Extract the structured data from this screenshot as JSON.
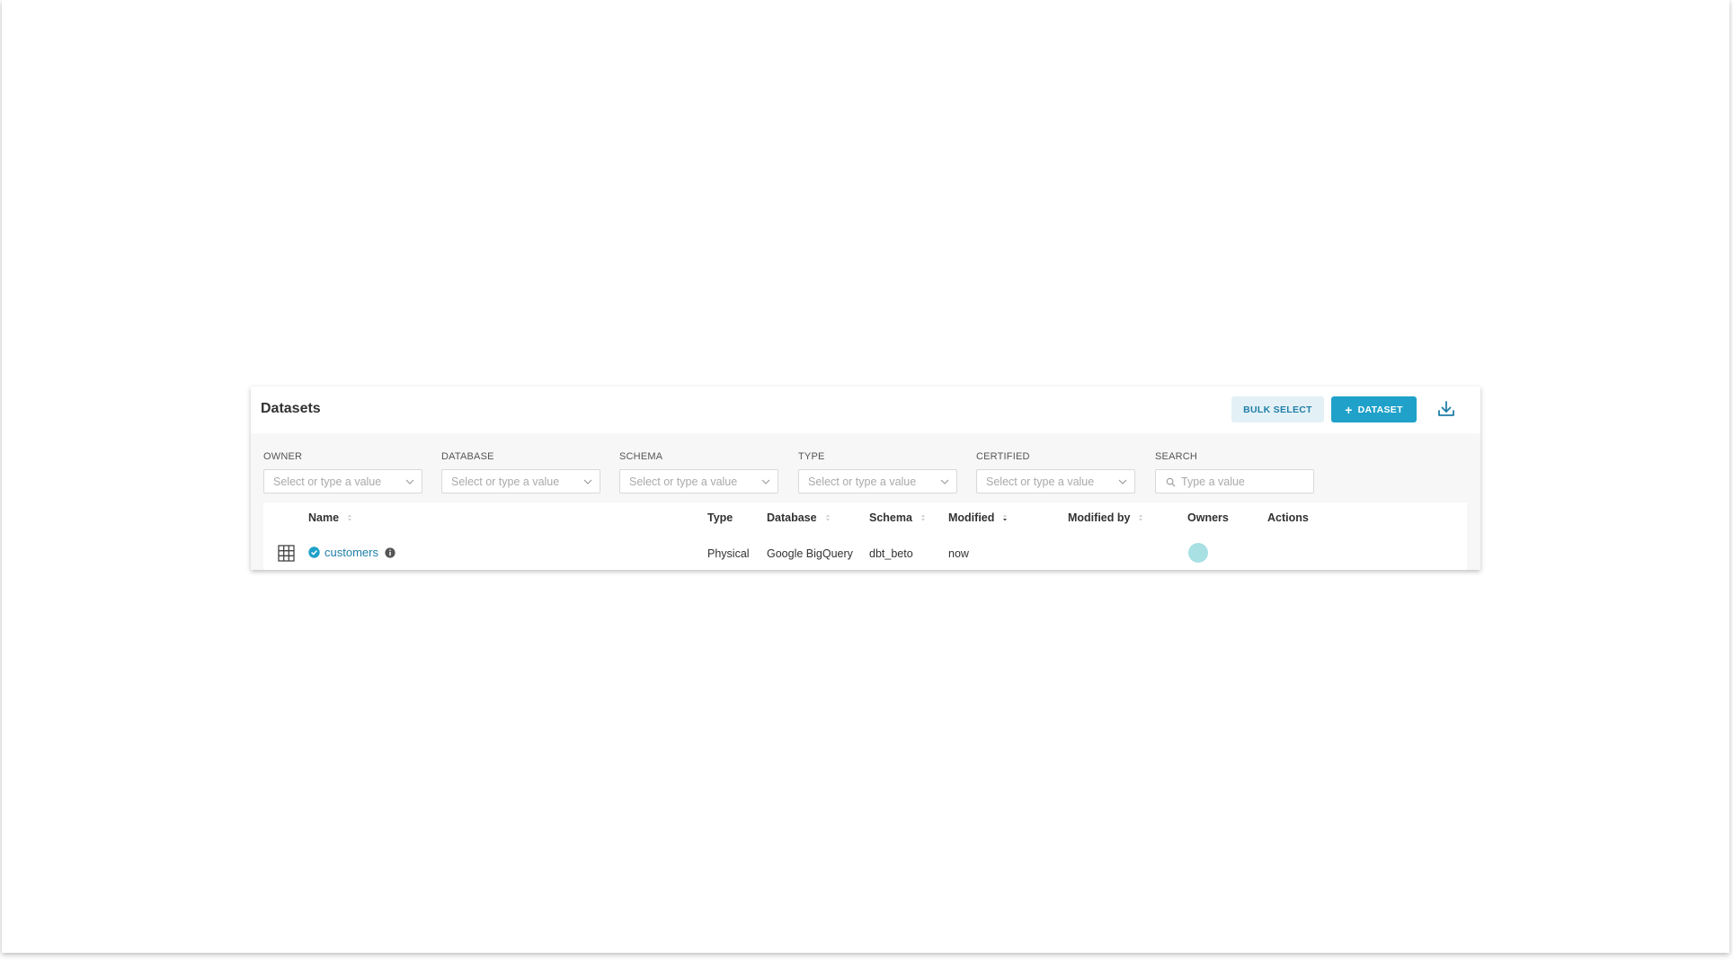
{
  "header": {
    "title": "Datasets",
    "bulk_select_label": "BULK SELECT",
    "add_dataset_label": "DATASET",
    "add_icon": "plus-icon",
    "download_icon": "download-icon"
  },
  "filters": [
    {
      "label": "OWNER",
      "placeholder": "Select or type a value"
    },
    {
      "label": "DATABASE",
      "placeholder": "Select or type a value"
    },
    {
      "label": "SCHEMA",
      "placeholder": "Select or type a value"
    },
    {
      "label": "TYPE",
      "placeholder": "Select or type a value"
    },
    {
      "label": "CERTIFIED",
      "placeholder": "Select or type a value"
    },
    {
      "label": "SEARCH",
      "placeholder": "Type a value"
    }
  ],
  "table": {
    "columns": [
      "Name",
      "Type",
      "Database",
      "Schema",
      "Modified",
      "Modified by",
      "Owners",
      "Actions"
    ],
    "rows": [
      {
        "name": "customers",
        "type": "Physical",
        "database": "Google BigQuery",
        "schema": "dbt_beto",
        "modified": "now",
        "modified_by": "",
        "certified": true
      }
    ]
  },
  "colors": {
    "primary": "#1fa1c9",
    "primary_light": "#e3f1f6",
    "link": "#1f7ea8",
    "avatar": "#a8e0e4"
  }
}
